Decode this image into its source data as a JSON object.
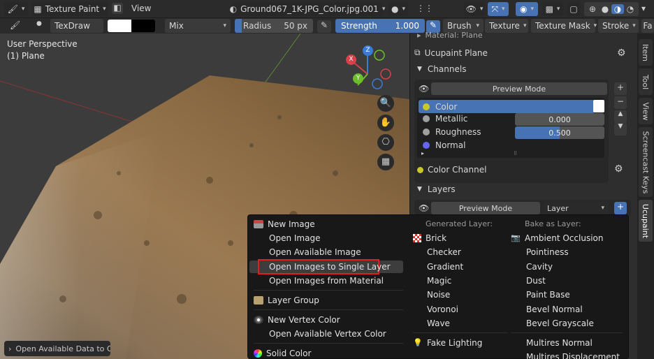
{
  "header": {
    "mode": "Texture Paint",
    "view": "View",
    "image_name": "Ground067_1K-JPG_Color.jpg.001"
  },
  "toolbar": {
    "brush": "TexDraw",
    "blend": "Mix",
    "radius_label": "Radius",
    "radius_value": "50 px",
    "strength_label": "Strength",
    "strength_value": "1.000",
    "brush_menu": "Brush",
    "texture_menu": "Texture",
    "texture_mask_menu": "Texture Mask",
    "stroke_menu": "Stroke",
    "falloff_menu": "Fa",
    "colors": {
      "primary": "#ffffff",
      "secondary": "#000000"
    }
  },
  "viewport": {
    "perspective": "User Perspective",
    "object": "(1) Plane",
    "status": "Open Available Data to Ov",
    "gizmo": {
      "x": "X",
      "y": "Y",
      "z": "Z"
    }
  },
  "panel": {
    "material": "Material: Plane",
    "addon": "Ucupaint Plane",
    "channels_header": "Channels",
    "preview_mode": "Preview Mode",
    "channels": [
      {
        "name": "Color",
        "value": "",
        "color": "#c8c82a"
      },
      {
        "name": "Metallic",
        "value": "0.000",
        "color": "#a0a0a0"
      },
      {
        "name": "Roughness",
        "value": "0.500",
        "color": "#a0a0a0"
      },
      {
        "name": "Normal",
        "value": "",
        "color": "#6464ff"
      }
    ],
    "color_channel": "Color Channel",
    "layers_header": "Layers",
    "layer_preview": "Preview Mode",
    "layer_type": "Layer"
  },
  "sidebar_tabs": [
    "Item",
    "Tool",
    "View",
    "Screencast Keys",
    "Ucupaint"
  ],
  "menu": {
    "left": [
      "New Image",
      "Open Image",
      "Open Available Image",
      "Open Images to Single Layer",
      "Open Images from Material",
      "Layer Group",
      "New Vertex Color",
      "Open Available Vertex Color",
      "Solid Color"
    ],
    "generated_header": "Generated Layer:",
    "generated": [
      "Brick",
      "Checker",
      "Gradient",
      "Magic",
      "Noise",
      "Voronoi",
      "Wave",
      "Fake Lighting"
    ],
    "bake_header": "Bake as Layer:",
    "bake": [
      "Ambient Occlusion",
      "Pointiness",
      "Cavity",
      "Dust",
      "Paint Base",
      "Bevel Normal",
      "Bevel Grayscale",
      "Multires Normal",
      "Multires Displacement"
    ],
    "highlight_color": "#e02020"
  }
}
